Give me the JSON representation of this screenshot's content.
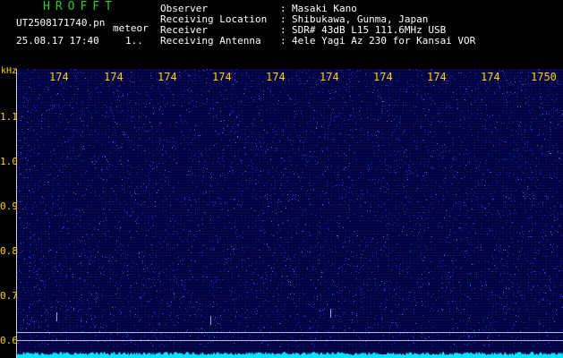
{
  "header": {
    "title": "HROFFT",
    "filename": "UT2508171740.pn",
    "filename_suffix": "meteor",
    "datetime": "25.08.17 17:40",
    "datetime_extra": "1..",
    "labels": [
      "Observer",
      "Receiving Location",
      "Receiver",
      "Receiving Antenna"
    ],
    "colons": [
      ":",
      ":",
      ":",
      ":"
    ],
    "values": [
      "Masaki Kano",
      "Shibukawa, Gunma, Japan",
      "SDR# 43dB L15 111.6MHz USB",
      "4ele Yagi Az 230 for Kansai VOR"
    ]
  },
  "axis": {
    "unit": "kHz",
    "x_ticks": [
      "174",
      "174",
      "174",
      "174",
      "174",
      "174",
      "174",
      "174",
      "174",
      "1750"
    ],
    "y_ticks": [
      "1.1",
      "1.0",
      "0.9",
      "0.8",
      "0.7",
      "0.6"
    ]
  },
  "colors": {
    "title": "#22cc22",
    "axis_text": "#ffd000",
    "header_text": "#ffffff",
    "spectrum": "#00e5ff",
    "noise": "#2a2ad0",
    "background": "#000000"
  }
}
